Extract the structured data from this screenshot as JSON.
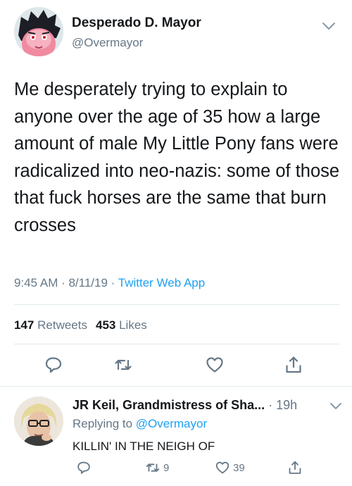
{
  "tweet": {
    "author_name": "Desperado D. Mayor",
    "author_handle": "@Overmayor",
    "text": "Me desperately trying to explain to anyone over the age of 35 how a large amount of male My Little Pony fans were radicalized into neo-nazis: some of those that fuck horses are the same that burn crosses",
    "time": "9:45 AM · 8/11/19 · ",
    "source": "Twitter Web App",
    "retweets_count": "147",
    "retweets_label": "Retweets",
    "likes_count": "453",
    "likes_label": "Likes"
  },
  "actions": {
    "reply_icon": "reply-icon",
    "retweet_icon": "retweet-icon",
    "like_icon": "heart-icon",
    "share_icon": "share-icon"
  },
  "reply": {
    "author_name": "JR Keil, Grandmistress of Sha...",
    "time": " · 19h",
    "replying_prefix": "Replying to ",
    "replying_handle": "@Overmayor",
    "text": "KILLIN' IN THE NEIGH OF",
    "retweet_count": "9",
    "like_count": "39"
  },
  "colors": {
    "text": "#14171a",
    "secondary": "#657786",
    "accent": "#1da1f2",
    "divider": "#e1e8ed"
  }
}
